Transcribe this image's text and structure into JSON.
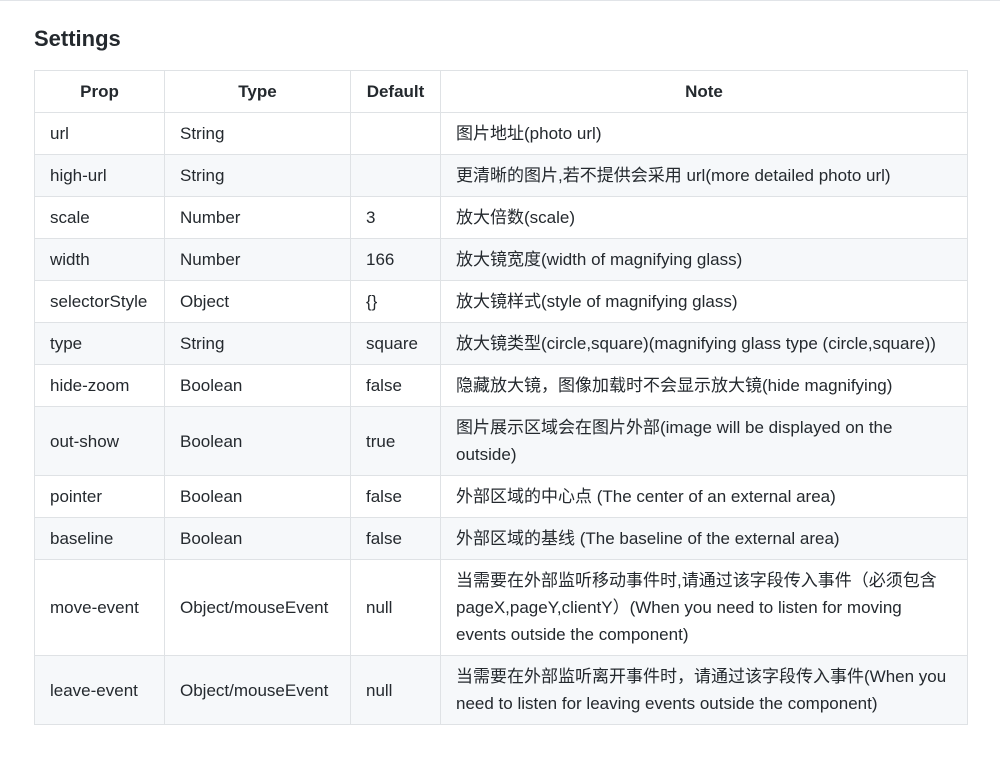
{
  "page": {
    "heading": "Settings"
  },
  "table": {
    "headers": {
      "prop": "Prop",
      "type": "Type",
      "default": "Default",
      "note": "Note"
    },
    "rows": [
      {
        "prop": "url",
        "type": "String",
        "default": "",
        "note": "图片地址(photo url)"
      },
      {
        "prop": "high-url",
        "type": "String",
        "default": "",
        "note": "更清晰的图片,若不提供会采用 url(more detailed photo url)"
      },
      {
        "prop": "scale",
        "type": "Number",
        "default": "3",
        "note": "放大倍数(scale)"
      },
      {
        "prop": "width",
        "type": "Number",
        "default": "166",
        "note": "放大镜宽度(width of magnifying glass)"
      },
      {
        "prop": "selectorStyle",
        "type": "Object",
        "default": "{}",
        "note": "放大镜样式(style of magnifying glass)"
      },
      {
        "prop": "type",
        "type": "String",
        "default": "square",
        "note": "放大镜类型(circle,square)(magnifying glass type (circle,square))"
      },
      {
        "prop": "hide-zoom",
        "type": "Boolean",
        "default": "false",
        "note": "隐藏放大镜，图像加载时不会显示放大镜(hide magnifying)"
      },
      {
        "prop": "out-show",
        "type": "Boolean",
        "default": "true",
        "note": "图片展示区域会在图片外部(image will be displayed on the outside)"
      },
      {
        "prop": "pointer",
        "type": "Boolean",
        "default": "false",
        "note": "外部区域的中心点 (The center of an external area)"
      },
      {
        "prop": "baseline",
        "type": "Boolean",
        "default": "false",
        "note": "外部区域的基线 (The baseline of the external area)"
      },
      {
        "prop": "move-event",
        "type": "Object/mouseEvent",
        "default": "null",
        "note": "当需要在外部监听移动事件时,请通过该字段传入事件（必须包含 pageX,pageY,clientY）(When you need to listen for moving events outside the component)"
      },
      {
        "prop": "leave-event",
        "type": "Object/mouseEvent",
        "default": "null",
        "note": "当需要在外部监听离开事件时，请通过该字段传入事件(When you need to listen for leaving events outside the component)"
      }
    ]
  }
}
